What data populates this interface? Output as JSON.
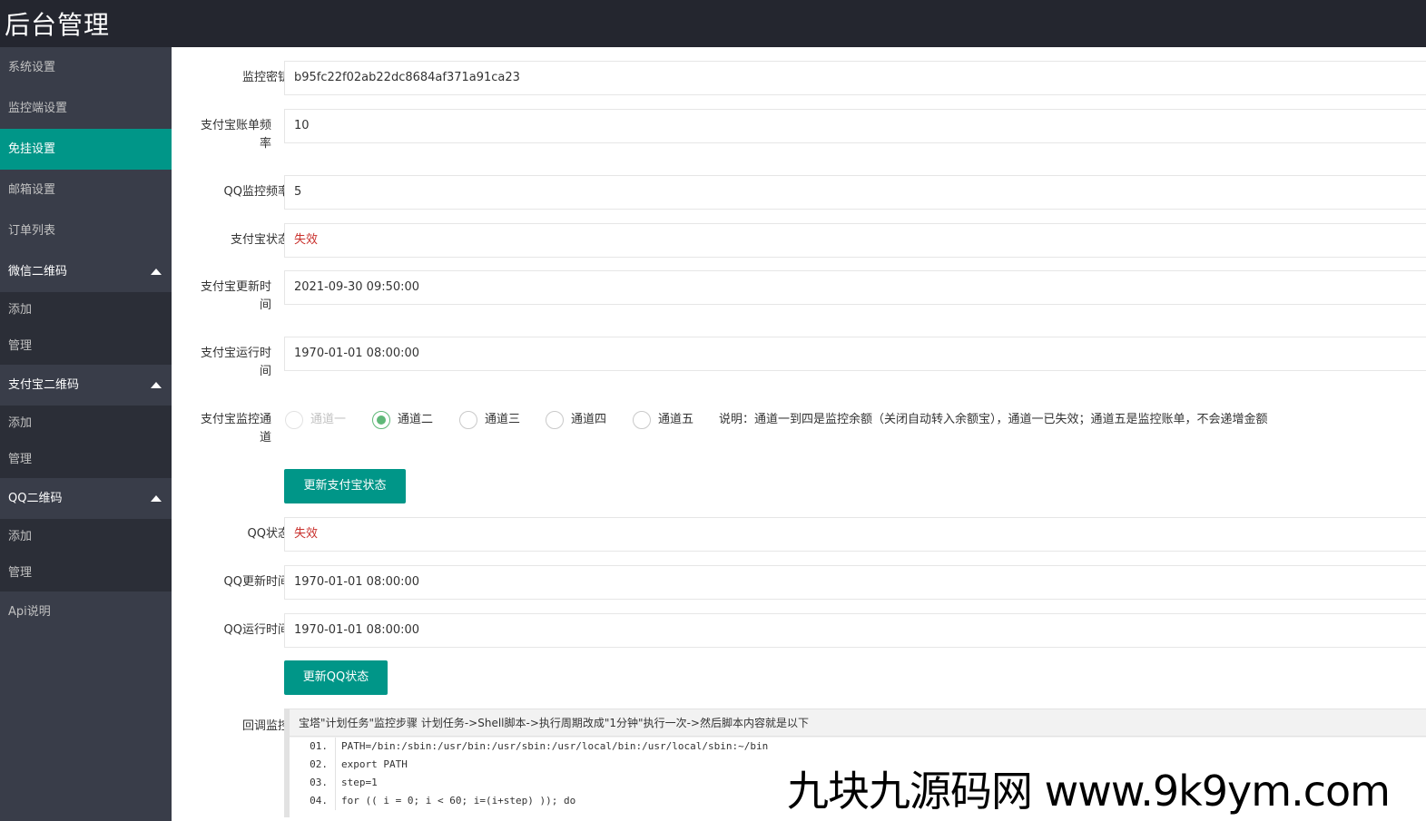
{
  "app": {
    "title": "后台管理"
  },
  "sidebar": {
    "items": [
      {
        "label": "系统设置"
      },
      {
        "label": "监控端设置"
      },
      {
        "label": "免挂设置",
        "active": true
      },
      {
        "label": "邮箱设置"
      },
      {
        "label": "订单列表"
      }
    ],
    "groups": [
      {
        "label": "微信二维码",
        "children": [
          {
            "label": "添加"
          },
          {
            "label": "管理"
          }
        ]
      },
      {
        "label": "支付宝二维码",
        "children": [
          {
            "label": "添加"
          },
          {
            "label": "管理"
          }
        ]
      },
      {
        "label": "QQ二维码",
        "children": [
          {
            "label": "添加"
          },
          {
            "label": "管理"
          }
        ]
      }
    ],
    "api": {
      "label": "Api说明"
    }
  },
  "form": {
    "monitor_key": {
      "label": "监控密钥",
      "value": "b95fc22f02ab22dc8684af371a91ca23"
    },
    "alipay_freq": {
      "label": "支付宝账单频率",
      "value": "10"
    },
    "qq_freq": {
      "label": "QQ监控频率",
      "value": "5"
    },
    "alipay_status": {
      "label": "支付宝状态",
      "value": "失效"
    },
    "alipay_update_time": {
      "label": "支付宝更新时间",
      "value": "2021-09-30 09:50:00"
    },
    "alipay_run_time": {
      "label": "支付宝运行时间",
      "value": "1970-01-01 08:00:00"
    },
    "alipay_channel": {
      "label": "支付宝监控通道",
      "options": [
        {
          "label": "通道一",
          "disabled": true,
          "checked": false
        },
        {
          "label": "通道二",
          "disabled": false,
          "checked": true
        },
        {
          "label": "通道三",
          "disabled": false,
          "checked": false
        },
        {
          "label": "通道四",
          "disabled": false,
          "checked": false
        },
        {
          "label": "通道五",
          "disabled": false,
          "checked": false
        }
      ],
      "note": "说明：通道一到四是监控余额（关闭自动转入余额宝），通道一已失效；通道五是监控账单，不会递增金额"
    },
    "update_alipay_button": "更新支付宝状态",
    "qq_status": {
      "label": "QQ状态",
      "value": "失效"
    },
    "qq_update_time": {
      "label": "QQ更新时间",
      "value": "1970-01-01 08:00:00"
    },
    "qq_run_time": {
      "label": "QQ运行时间",
      "value": "1970-01-01 08:00:00"
    },
    "update_qq_button": "更新QQ状态",
    "callback": {
      "label": "回调监控",
      "head": "宝塔\"计划任务\"监控步骤 计划任务->Shell脚本->执行周期改成\"1分钟\"执行一次->然后脚本内容就是以下",
      "lines": [
        {
          "num": "01.",
          "text": "PATH=/bin:/sbin:/usr/bin:/usr/sbin:/usr/local/bin:/usr/local/sbin:~/bin"
        },
        {
          "num": "02.",
          "text": "export PATH"
        },
        {
          "num": "03.",
          "text": "step=1"
        },
        {
          "num": "04.",
          "text": "for (( i = 0; i < 60; i=(i+step) )); do"
        }
      ]
    }
  },
  "watermark": "九块九源码网 www.9k9ym.com",
  "colors": {
    "accent": "#009688",
    "sidebar": "#393d49",
    "topbar": "#24262f",
    "danger": "#c9302c",
    "radio": "#5fb878"
  }
}
